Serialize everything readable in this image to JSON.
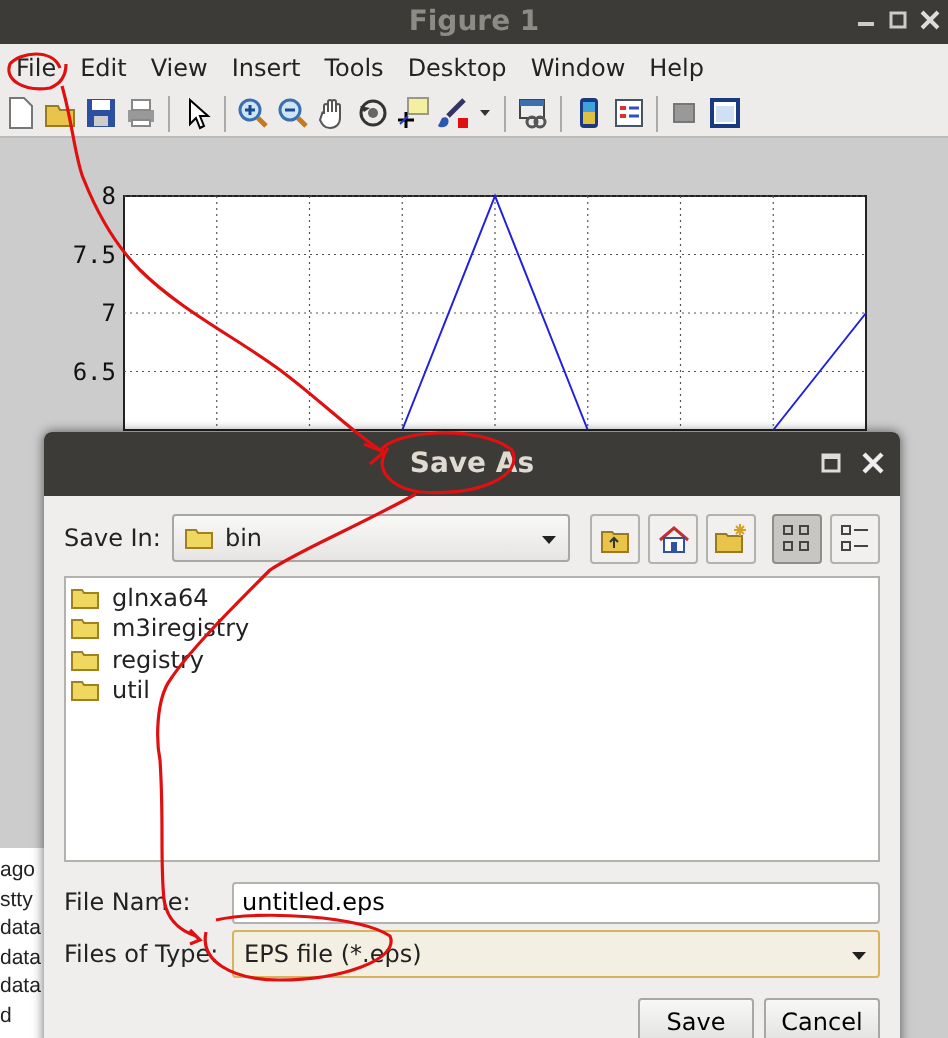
{
  "window": {
    "title": "Figure 1"
  },
  "menu": [
    "File",
    "Edit",
    "View",
    "Insert",
    "Tools",
    "Desktop",
    "Window",
    "Help"
  ],
  "figure": {
    "y_ticks": [
      "8",
      "7.5",
      "7",
      "6.5"
    ]
  },
  "command_window": {
    "lines": [
      "ago",
      "stty",
      "data",
      "data",
      "data",
      "d"
    ]
  },
  "dialog": {
    "title": "Save As",
    "save_in": {
      "label": "Save In:",
      "value": "bin"
    },
    "view_buttons": [
      {
        "selected": true
      },
      {
        "selected": false
      }
    ],
    "files": [
      "glnxa64",
      "m3iregistry",
      "registry",
      "util"
    ],
    "file_name": {
      "label": "File Name:",
      "value": "untitled.eps"
    },
    "file_type": {
      "label": "Files of Type:",
      "value": "EPS file (*.eps)"
    },
    "buttons": [
      "Save",
      "Cancel"
    ]
  }
}
